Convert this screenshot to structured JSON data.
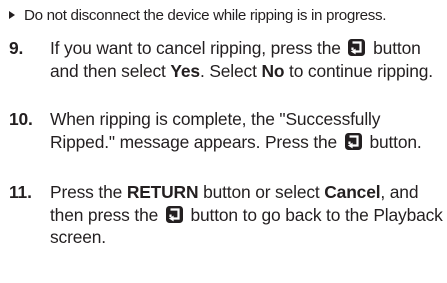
{
  "note": {
    "text": "Do not disconnect the device while ripping is in progress."
  },
  "steps": [
    {
      "number": "9.",
      "parts": {
        "a": "If you want to cancel ripping, press the",
        "b": "button and then select",
        "yes": "Yes",
        "c": ". Select",
        "no": "No",
        "d": "to continue ripping."
      }
    },
    {
      "number": "10.",
      "parts": {
        "a": "When ripping is complete, the \"Successfully Ripped.\" message appears. Press the",
        "b": "button."
      }
    },
    {
      "number": "11.",
      "parts": {
        "a": "Press the",
        "return": "RETURN",
        "b": "button or select",
        "cancel": "Cancel",
        "c": ", and then press the",
        "d": "button to go back to the Playback screen."
      }
    }
  ],
  "icons": {
    "bullet": "triangle-bullet-icon",
    "enter": "enter-button-icon"
  },
  "colors": {
    "text": "#231f20",
    "background": "#ffffff"
  }
}
